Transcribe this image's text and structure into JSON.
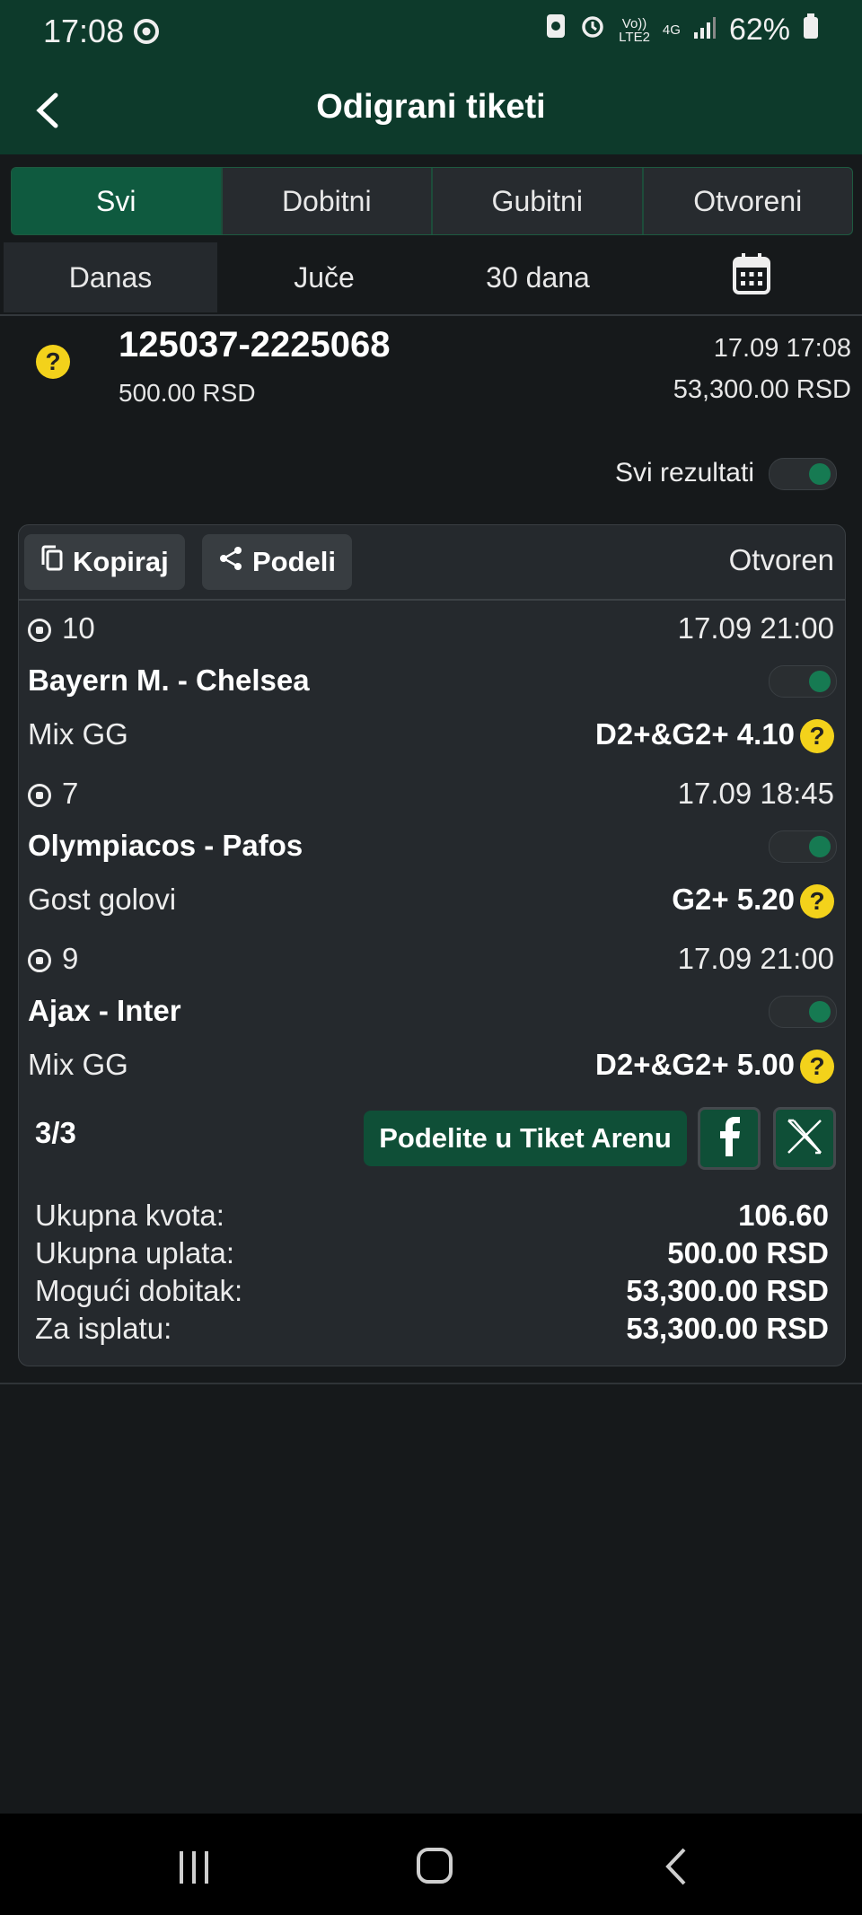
{
  "status_bar": {
    "time": "17:08",
    "net_top": "Vo))",
    "net_bottom": "LTE2",
    "net4g": "4G",
    "battery": "62%"
  },
  "header": {
    "title": "Odigrani tiketi"
  },
  "filter_tabs": [
    "Svi",
    "Dobitni",
    "Gubitni",
    "Otvoreni"
  ],
  "period_tabs": [
    "Danas",
    "Juče",
    "30 dana"
  ],
  "ticket": {
    "id": "125037-2225068",
    "stake": "500.00 RSD",
    "datetime": "17.09 17:08",
    "possible_win": "53,300.00 RSD"
  },
  "all_results_label": "Svi rezultati",
  "card": {
    "copy_label": "Kopiraj",
    "share_label": "Podeli",
    "status": "Otvoren",
    "matches": [
      {
        "code": "10",
        "time": "17.09 21:00",
        "teams": "Bayern M. - Chelsea",
        "market": "Mix GG",
        "pick": "D2+&G2+ 4.10"
      },
      {
        "code": "7",
        "time": "17.09 18:45",
        "teams": "Olympiacos - Pafos",
        "market": "Gost golovi",
        "pick": "G2+ 5.20"
      },
      {
        "code": "9",
        "time": "17.09 21:00",
        "teams": "Ajax - Inter",
        "market": "Mix GG",
        "pick": "D2+&G2+ 5.00"
      }
    ],
    "count": "3/3",
    "arena_label": "Podelite u Tiket Arenu",
    "summary": [
      {
        "label": "Ukupna kvota:",
        "value": "106.60"
      },
      {
        "label": "Ukupna uplata:",
        "value": "500.00 RSD"
      },
      {
        "label": "Mogući dobitak:",
        "value": "53,300.00 RSD"
      },
      {
        "label": "Za isplatu:",
        "value": "53,300.00 RSD"
      }
    ]
  },
  "colors": {
    "header_bg": "#0d3a2b",
    "accent": "#0f5a3f",
    "toggle_on": "#167a52",
    "help_badge": "#f3d21b"
  }
}
